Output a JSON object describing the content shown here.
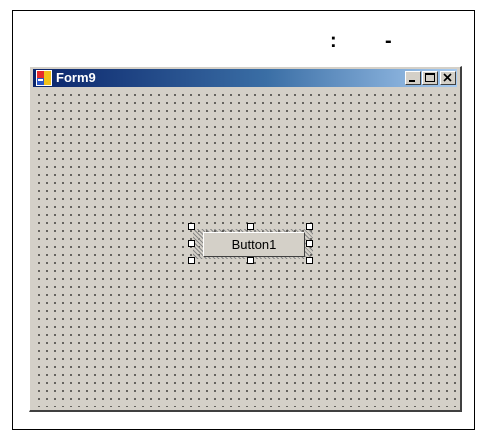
{
  "caption": {
    "left_mark": ":",
    "right_mark": "-"
  },
  "window": {
    "title": "Form9",
    "app_icon": "form-app-icon",
    "buttons": [
      "minimize-icon",
      "maximize-icon",
      "close-icon"
    ]
  },
  "form": {
    "button1_label": "Button1"
  }
}
